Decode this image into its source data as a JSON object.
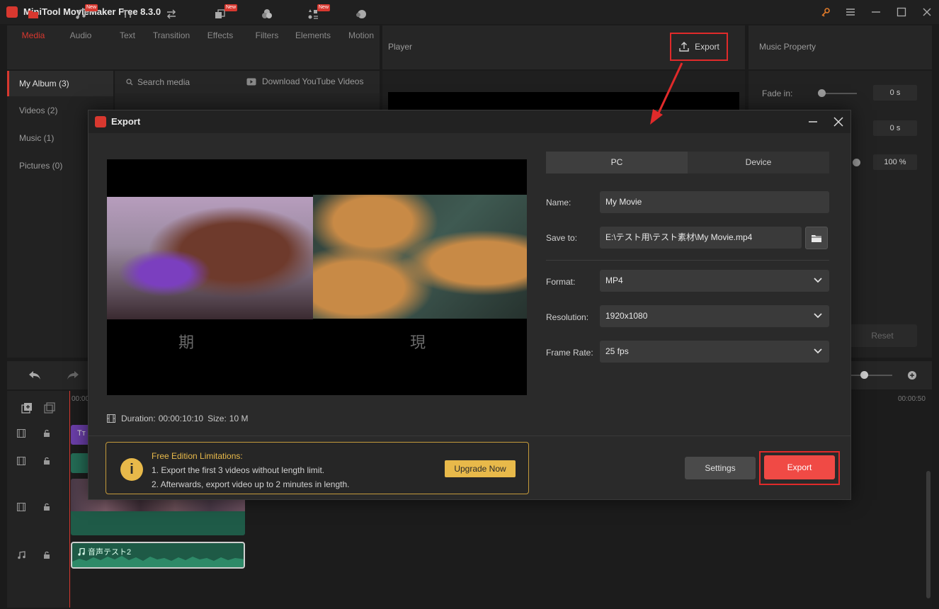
{
  "app": {
    "title": "MiniTool MovieMaker Free 8.3.0"
  },
  "toolbar": {
    "items": [
      {
        "label": "Media",
        "icon": "folder-icon",
        "new": false,
        "active": true
      },
      {
        "label": "Audio",
        "icon": "music-icon",
        "new": true,
        "active": false
      },
      {
        "label": "Text",
        "icon": "text-icon",
        "new": false,
        "active": false
      },
      {
        "label": "Transition",
        "icon": "transition-icon",
        "new": false,
        "active": false
      },
      {
        "label": "Effects",
        "icon": "effects-icon",
        "new": true,
        "active": false
      },
      {
        "label": "Filters",
        "icon": "filters-icon",
        "new": false,
        "active": false
      },
      {
        "label": "Elements",
        "icon": "elements-icon",
        "new": true,
        "active": false
      },
      {
        "label": "Motion",
        "icon": "motion-icon",
        "new": false,
        "active": false
      }
    ],
    "new_badge": "New"
  },
  "media_sidebar": {
    "items": [
      {
        "label": "My Album (3)"
      },
      {
        "label": "Videos (2)"
      },
      {
        "label": "Music (1)"
      },
      {
        "label": "Pictures (0)"
      }
    ]
  },
  "media_search": {
    "placeholder": "Search media",
    "download_label": "Download YouTube Videos"
  },
  "player": {
    "label": "Player",
    "export_label": "Export"
  },
  "music_property": {
    "label": "Music Property",
    "fade_in_label": "Fade in:",
    "fade_in_value": "0 s",
    "fade_out_value": "0 s",
    "volume_value": "100 %",
    "reset_label": "Reset"
  },
  "timeline": {
    "time_start": "00:00",
    "time_end": "00:00:50",
    "text_clip_label": "Tт",
    "audio_clip_name": "音声テスト2"
  },
  "dialog": {
    "title": "Export",
    "tabs": {
      "pc": "PC",
      "device": "Device"
    },
    "name_label": "Name:",
    "name_value": "My Movie",
    "save_to_label": "Save to:",
    "save_to_value": "E:\\テスト用\\テスト素材\\My Movie.mp4",
    "format_label": "Format:",
    "format_value": "MP4",
    "resolution_label": "Resolution:",
    "resolution_value": "1920x1080",
    "frame_rate_label": "Frame Rate:",
    "frame_rate_value": "25 fps",
    "preview_subtitle_left": "期",
    "preview_subtitle_right": "現",
    "duration_label": "Duration:",
    "duration_value": "00:00:10:10",
    "size_label": "Size:",
    "size_value": "10 M",
    "limit_title": "Free Edition Limitations:",
    "limit_line1": "1. Export the first 3 videos without length limit.",
    "limit_line2": "2. Afterwards, export video up to 2 minutes in length.",
    "upgrade_label": "Upgrade Now",
    "settings_label": "Settings",
    "export_label": "Export"
  },
  "colors": {
    "accent": "#d8382f",
    "export_button": "#f04a45",
    "highlight_frame": "#e02a2a",
    "warning": "#e8b94a"
  }
}
